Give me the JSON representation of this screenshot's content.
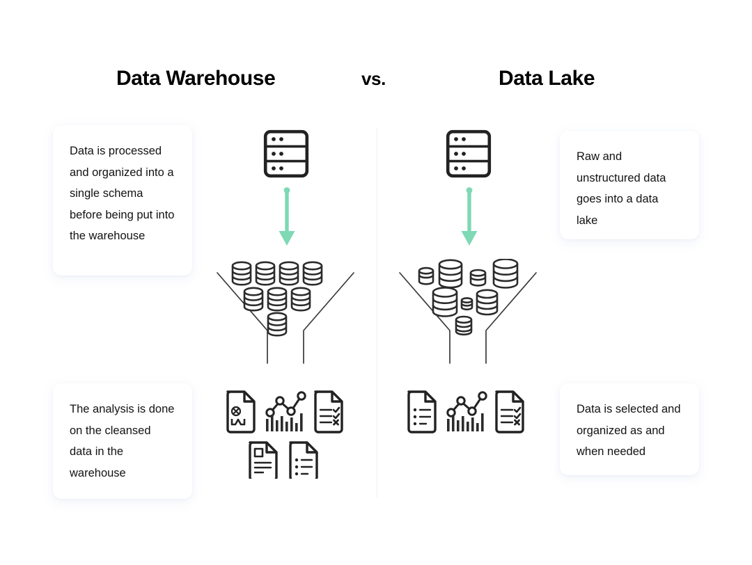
{
  "diagram": {
    "type": "comparison-diagram",
    "background_color": "#ffffff",
    "accent_color": "#7ed9b4",
    "ink_color": "#2b2b2b",
    "divider_color": "#eaeef8"
  },
  "headings": {
    "left": "Data Warehouse",
    "middle": "vs.",
    "right": "Data Lake"
  },
  "cards": {
    "top_left": {
      "text": "Data is processed and organized into a single schema before being put into the warehouse"
    },
    "bottom_left": {
      "text": "The analysis is done on the cleansed data in the warehouse"
    },
    "top_right": {
      "text": "Raw and unstructured data goes into a data lake"
    },
    "bottom_right": {
      "text": "Data is selected and organized as and when needed"
    }
  },
  "columns": {
    "left": {
      "name": "data-warehouse",
      "source_icon": "server-rack-icon",
      "flow_icon": "green-down-arrow-icon",
      "funnel_icon": "funnel-icon",
      "funnel_contents": "uniform-database-stacks",
      "funnel_stack_count": 8,
      "output_icons": [
        "chart-document-icon",
        "analytics-chart-icon",
        "checklist-document-icon",
        "image-document-icon",
        "list-document-icon"
      ]
    },
    "right": {
      "name": "data-lake",
      "source_icon": "server-rack-icon",
      "flow_icon": "green-down-arrow-icon",
      "funnel_icon": "funnel-icon",
      "funnel_contents": "varied-size-database-stacks",
      "funnel_stack_count": 8,
      "output_icons": [
        "bullet-list-document-icon",
        "analytics-chart-icon",
        "checklist-document-icon"
      ]
    }
  }
}
